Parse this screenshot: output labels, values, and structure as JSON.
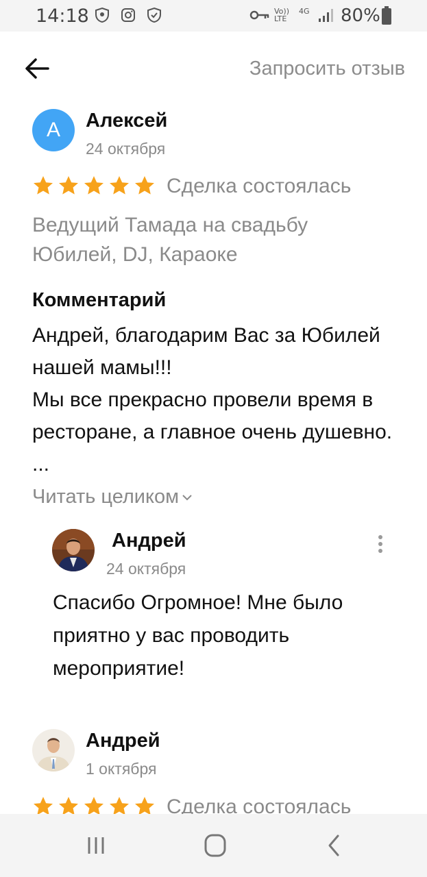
{
  "status_bar": {
    "time": "14:18",
    "volte_label": "Vo)) LTE",
    "network_label": "4G",
    "battery": "80%",
    "icons": [
      "shield-icon",
      "instagram-icon",
      "vpn-shield-icon",
      "key-icon",
      "signal-icon",
      "battery-icon"
    ]
  },
  "header": {
    "back_icon": "arrow-left-icon",
    "request_review": "Запросить отзыв"
  },
  "reviews": [
    {
      "avatar_letter": "A",
      "avatar_color": "#42a5f5",
      "author": "Алексей",
      "date": "24 октября",
      "rating": 5,
      "deal_status": "Сделка состоялась",
      "service": "Ведущий Тамада на свадьбу Юбилей, DJ, Караоке",
      "comment_heading": "Комментарий",
      "comment": "Андрей, благодарим Вас за Юбилей нашей мамы!!!\nМы все прекрасно провели время в ресторане, а главное очень душевно. ...",
      "read_more": "Читать целиком",
      "reply": {
        "author": "Андрей",
        "date": "24 октября",
        "text": "Спасибо Огромное! Мне было приятно у вас проводить мероприятие!"
      }
    },
    {
      "author": "Андрей",
      "date": "1 октября",
      "rating": 5,
      "deal_status": "Сделка состоялась"
    }
  ],
  "colors": {
    "star": "#f7a21b",
    "avatar_blue": "#42a5f5",
    "muted_text": "#8a8a8a"
  },
  "nav_bar": {
    "icons": [
      "recent-apps-icon",
      "home-icon",
      "back-icon"
    ]
  }
}
